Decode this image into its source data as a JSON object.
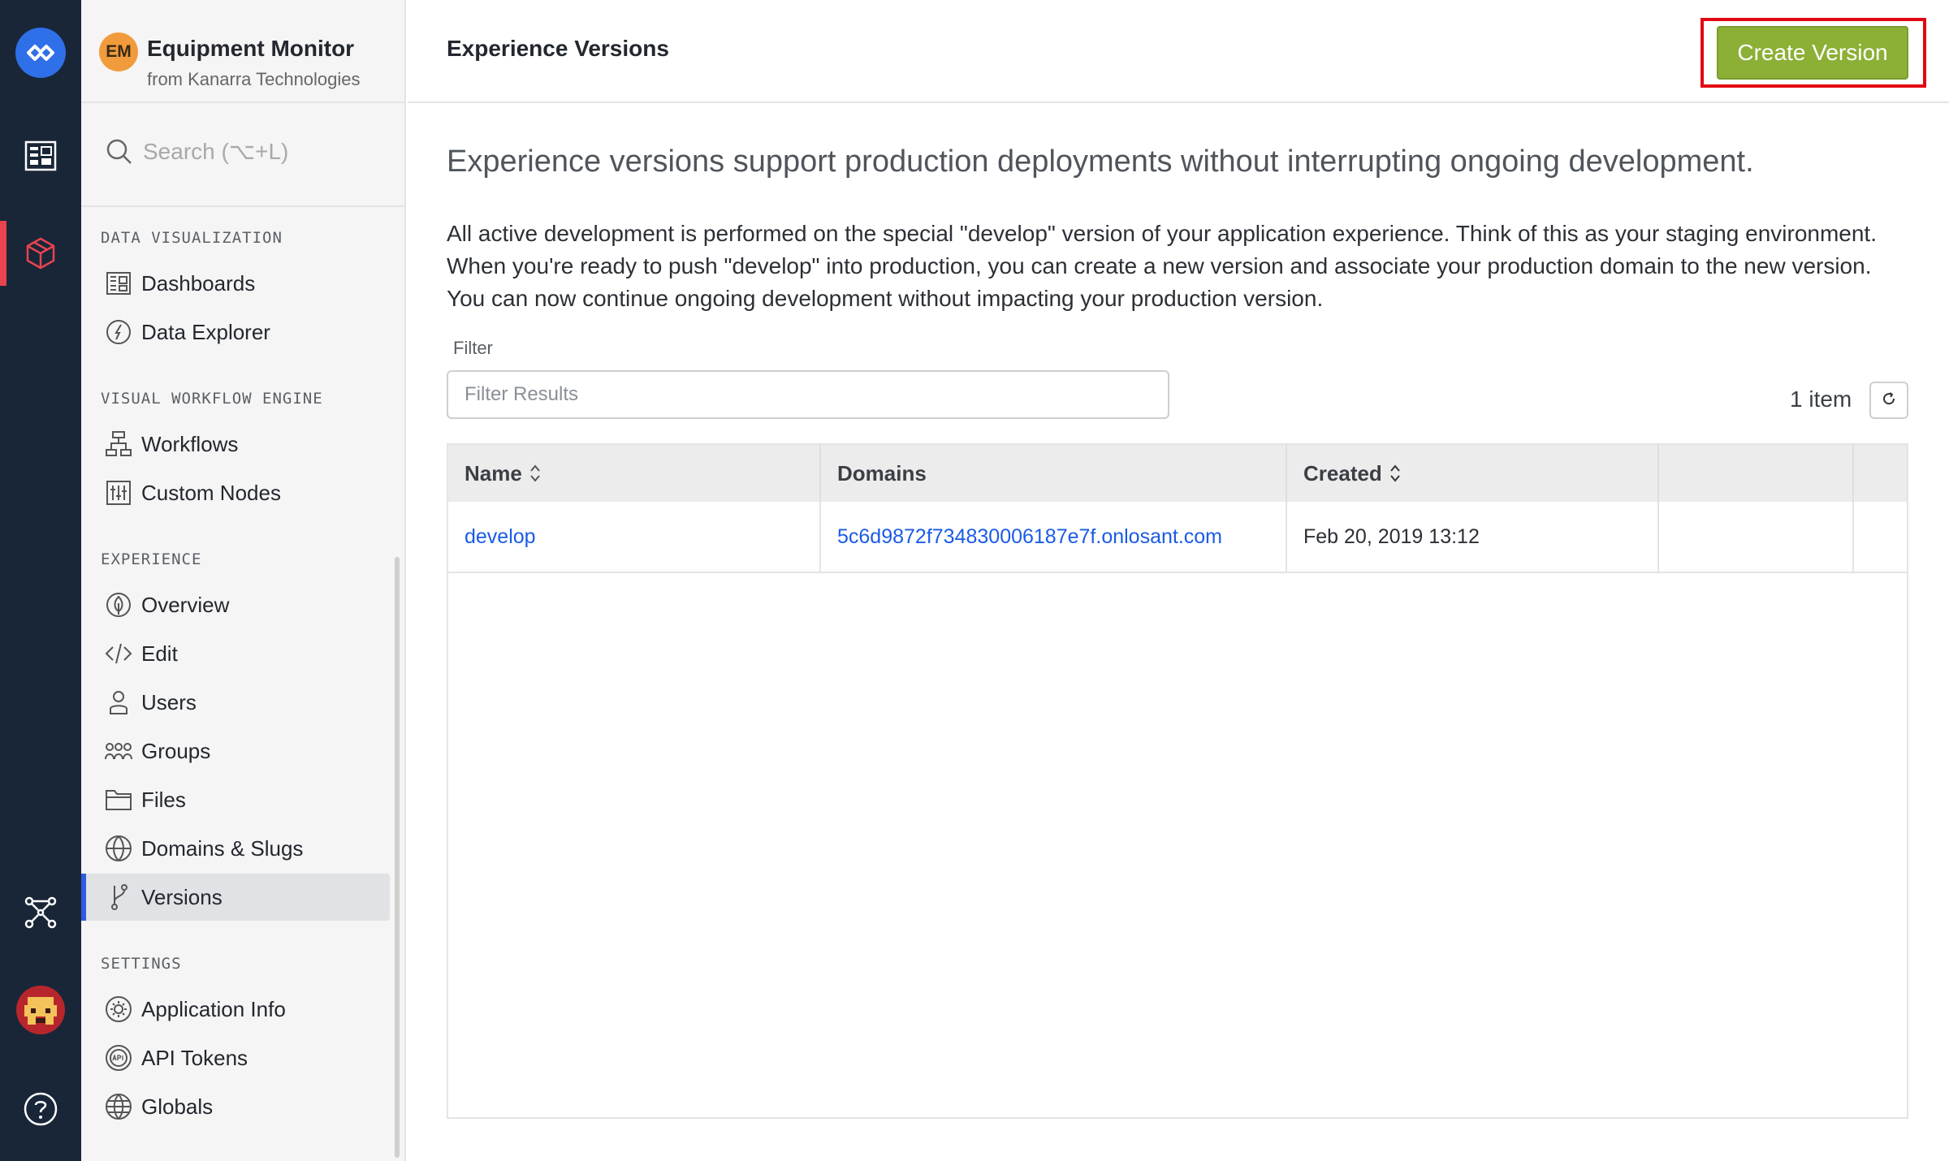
{
  "app": {
    "badge": "EM",
    "name": "Equipment Monitor",
    "org": "from Kanarra Technologies"
  },
  "search": {
    "placeholder": "Search (⌥+L)"
  },
  "sidebar": {
    "sections": [
      {
        "title": "DATA VISUALIZATION",
        "items": [
          {
            "label": "Dashboards",
            "icon": "dashboard-icon"
          },
          {
            "label": "Data Explorer",
            "icon": "compass-icon"
          }
        ]
      },
      {
        "title": "VISUAL WORKFLOW ENGINE",
        "items": [
          {
            "label": "Workflows",
            "icon": "workflow-icon"
          },
          {
            "label": "Custom Nodes",
            "icon": "sliders-icon"
          }
        ]
      },
      {
        "title": "EXPERIENCE",
        "items": [
          {
            "label": "Overview",
            "icon": "leaf-icon"
          },
          {
            "label": "Edit",
            "icon": "code-icon"
          },
          {
            "label": "Users",
            "icon": "user-icon"
          },
          {
            "label": "Groups",
            "icon": "group-icon"
          },
          {
            "label": "Files",
            "icon": "folder-icon"
          },
          {
            "label": "Domains & Slugs",
            "icon": "www-icon"
          },
          {
            "label": "Versions",
            "icon": "branch-icon",
            "active": true
          }
        ]
      },
      {
        "title": "SETTINGS",
        "items": [
          {
            "label": "Application Info",
            "icon": "gear-icon"
          },
          {
            "label": "API Tokens",
            "icon": "api-icon"
          },
          {
            "label": "Globals",
            "icon": "globe-icon"
          }
        ]
      }
    ]
  },
  "header": {
    "title": "Experience Versions",
    "create_label": "Create Version"
  },
  "main": {
    "lead": "Experience versions support production deployments without interrupting ongoing development.",
    "description": "All active development is performed on the special \"develop\" version of your application experience. Think of this as your staging environment. When you're ready to push \"develop\" into production, you can create a new version and associate your production domain to the new version. You can now continue ongoing development without impacting your production version.",
    "filter_label": "Filter",
    "filter_placeholder": "Filter Results",
    "item_count": "1 item"
  },
  "table": {
    "columns": [
      "Name",
      "Domains",
      "Created"
    ],
    "rows": [
      {
        "name": "develop",
        "domain": "5c6d9872f734830006187e7f.onlosant.com",
        "created": "Feb 20, 2019 13:12"
      }
    ]
  },
  "colors": {
    "rail": "#192638",
    "accent_blue": "#2f6fe8",
    "create_green": "#8cb036",
    "highlight_red": "#e30613",
    "link": "#1a5be6"
  }
}
